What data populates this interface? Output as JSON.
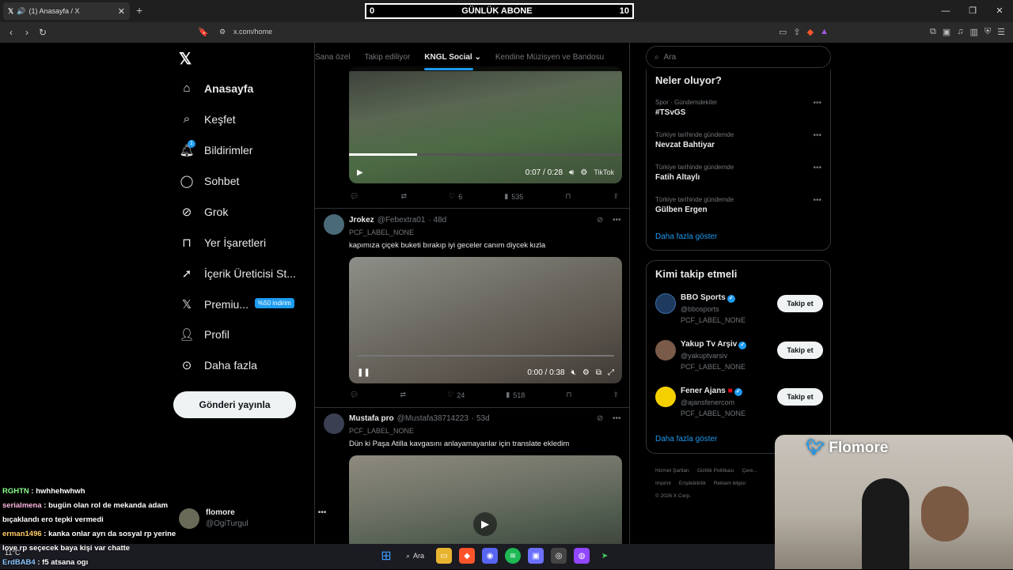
{
  "browser": {
    "tab_title": "(1) Anasayfa / X",
    "url": "x.com/home"
  },
  "overlay": {
    "left_value": "0",
    "title": "GÜNLÜK ABONE",
    "right_value": "10"
  },
  "nav": {
    "items": [
      "Anasayfa",
      "Keşfet",
      "Bildirimler",
      "Sohbet",
      "Grok",
      "Yer İşaretleri",
      "İçerik Üreticisi St...",
      "Premiu...",
      "Profil",
      "Daha fazla"
    ],
    "premium_badge": "%50 indirim",
    "post_button": "Gönderi yayınla",
    "notif_count": "1",
    "account_name": "flomore",
    "account_handle": "@OgiTurgul"
  },
  "feed_tabs": [
    "Sana özel",
    "Takip ediliyor",
    "KNGL Social",
    "Kendine Müzisyen ve Bandosu"
  ],
  "tweets": [
    {
      "video_time": "0:07 / 0:28",
      "watermark": "TikTok",
      "replies": "",
      "retweets": "",
      "likes": "6",
      "views": "535"
    },
    {
      "name": "Jrokez",
      "handle": "@Febextra01",
      "age": "· 48d",
      "label": "PCF_LABEL_NONE",
      "text": "kapımıza çiçek buketi bırakıp iyi geceler canım diycek kızla",
      "video_time": "0:00 / 0:38",
      "likes": "24",
      "views": "518"
    },
    {
      "name": "Mustafa pro",
      "handle": "@Mustafa38714223",
      "age": "· 53d",
      "label": "PCF_LABEL_NONE",
      "text": "Dün ki Paşa Atilla kavgasını anlayamayanlar için translate ekledim"
    }
  ],
  "search_placeholder": "Ara",
  "trends": {
    "title": "Neler oluyor?",
    "items": [
      {
        "category": "Spor · Gündemdekiler",
        "name": "#TSvGS"
      },
      {
        "category": "Türkiye tarihinde gündemde",
        "name": "Nevzat Bahtiyar"
      },
      {
        "category": "Türkiye tarihinde gündemde",
        "name": "Fatih Altaylı"
      },
      {
        "category": "Türkiye tarihinde gündemde",
        "name": "Gülben Ergen"
      }
    ],
    "more": "Daha fazla göster"
  },
  "who_to_follow": {
    "title": "Kimi takip etmeli",
    "items": [
      {
        "name": "BBO Sports",
        "handle": "@bbosports",
        "label": "PCF_LABEL_NONE",
        "button": "Takip et"
      },
      {
        "name": "Yakup Tv Arşiv",
        "handle": "@yakuptvarsiv",
        "label": "PCF_LABEL_NONE",
        "button": "Takip et"
      },
      {
        "name": "Fener Ajans",
        "handle": "@ajansfenercom",
        "label": "PCF_LABEL_NONE",
        "button": "Takip et"
      }
    ],
    "more": "Daha fazla göster"
  },
  "footer": {
    "links": [
      "Hizmet Şartları",
      "Gizlilik Politikası",
      "Çere...",
      "Imprint",
      "Erişilebilirlik",
      "Reklam bilgisi"
    ],
    "copyright": "© 2026 X Corp."
  },
  "chat": [
    {
      "user": "RGHTN",
      "msg": "hwhhehwhwh",
      "color": "#8cff8c"
    },
    {
      "user": "serialmena",
      "msg": "bugün olan rol de mekanda adam bıçaklandı ero tepki vermedi",
      "color": "#ffb6e0"
    },
    {
      "user": "erman1496",
      "msg": "kanka onlar ayrı da sosyal rp yerine love rp seçecek baya kişi var chatte",
      "color": "#ffcc66"
    },
    {
      "user": "ErdBAB4",
      "msg": "f5 atsana ogı",
      "color": "#8ac7ff"
    }
  ],
  "webcam": {
    "name": "Flomore"
  },
  "taskbar": {
    "search": "Ara",
    "weather": "11°C"
  }
}
